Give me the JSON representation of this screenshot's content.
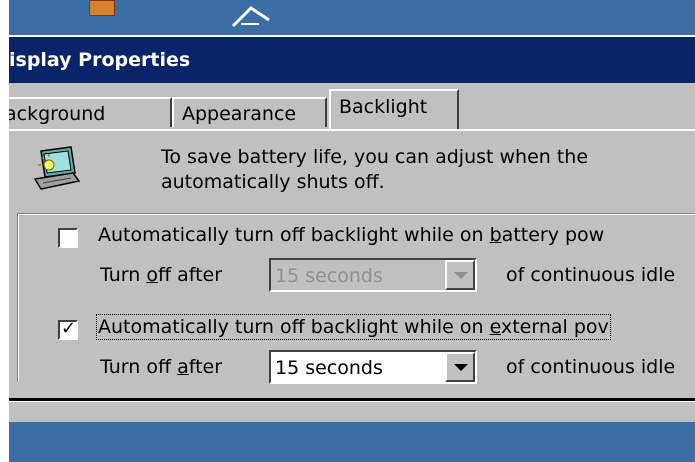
{
  "window": {
    "title": "isplay Properties"
  },
  "tabs": [
    {
      "label": "ackground"
    },
    {
      "label": "Appearance"
    },
    {
      "label": "Backlight"
    }
  ],
  "panel": {
    "info_line1": "To save battery life, you can adjust when the",
    "info_line2": "automatically shuts off.",
    "battery": {
      "checked": false,
      "label_pre": "Automatically turn off backlight while on ",
      "label_accel": "b",
      "label_post": "attery pow",
      "turn_off_pre": "Turn ",
      "turn_off_accel": "o",
      "turn_off_post": "ff after",
      "value": "15 seconds",
      "suffix": "of continuous idle"
    },
    "external": {
      "checked": true,
      "check_glyph": "✓",
      "label_pre": "Automatically turn off backlight while on ",
      "label_accel": "e",
      "label_post": "xternal pov",
      "turn_off_pre": "Turn off ",
      "turn_off_accel": "a",
      "turn_off_post": "fter",
      "value": "15 seconds",
      "suffix": "of continuous idle"
    }
  },
  "colors": {
    "desktop": "#3a6ea5",
    "titlebar": "#0a246a",
    "dialog_face": "#c0c0c0"
  }
}
